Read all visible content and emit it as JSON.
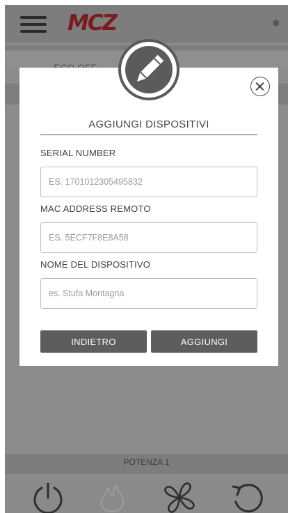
{
  "app": {
    "logo": "MCZ",
    "mode_label": "ECO OFF",
    "potenza_label": "POTENZA 1",
    "icons": [
      "menu-icon",
      "snowflake-icon",
      "power-icon",
      "flame-icon",
      "fan-icon",
      "refresh-icon"
    ]
  },
  "modal": {
    "title": "AGGIUNGI DISPOSITIVI",
    "serial": {
      "label": "SERIAL NUMBER",
      "placeholder": "ES. 1701012305495832",
      "value": ""
    },
    "mac": {
      "label": "MAC ADDRESS REMOTO",
      "placeholder": "ES. 5ECF7F8E8A58",
      "value": ""
    },
    "name": {
      "label": "NOME DEL DISPOSITIVO",
      "placeholder": "es. Stufa Montagna",
      "value": ""
    },
    "back_label": "INDIETRO",
    "add_label": "AGGIUNGI"
  },
  "colors": {
    "brand": "#7a1b1e",
    "overlay_gray": "#8c8c8c",
    "button_gray": "#5d5d5d"
  }
}
